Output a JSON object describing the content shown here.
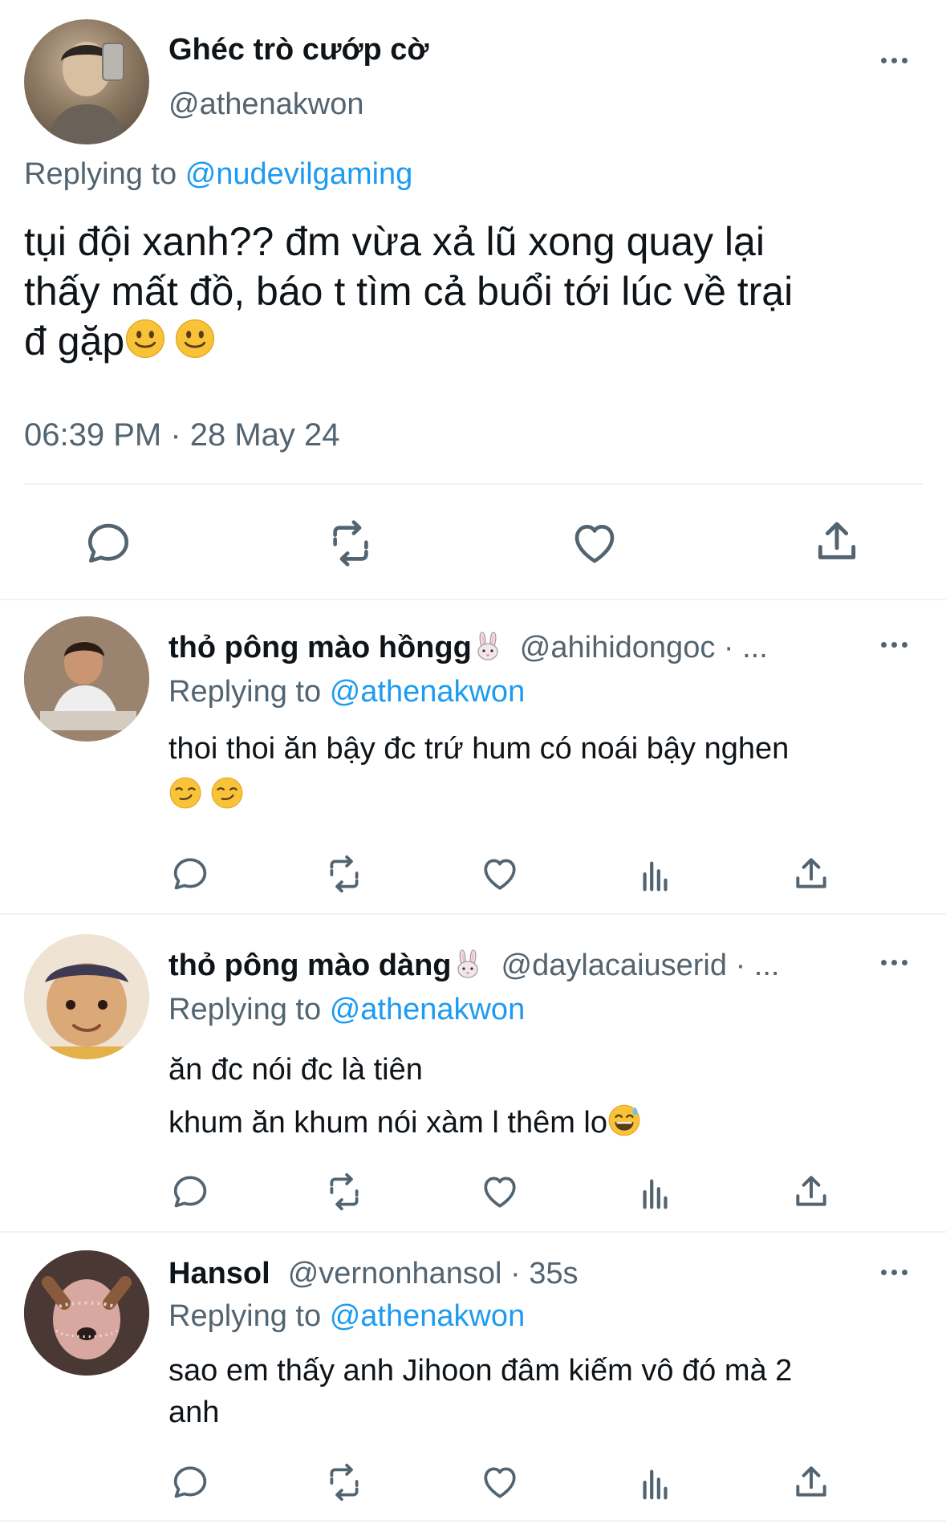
{
  "main_tweet": {
    "display_name": "Ghéc trò cướp cờ",
    "handle": "@athenakwon",
    "replying_label": "Replying to",
    "replying_to": "@nudevilgaming",
    "text_line1": "tụi đội xanh?? đm vừa xả lũ xong quay lại",
    "text_line2": "thấy mất đồ, báo t tìm cả buổi tới lúc về trại",
    "text_line3": "đ gặp",
    "timestamp": "06:39 PM · 28 May 24"
  },
  "replies": [
    {
      "display_name": "thỏ pông mào hồngg",
      "handle_meta": "@ahihidongoc · ...",
      "replying_label": "Replying to",
      "replying_to": "@athenakwon",
      "text_line1": "thoi thoi ăn bậy đc trứ hum có noái bậy nghen"
    },
    {
      "display_name": "thỏ pông mào dàng",
      "handle_meta": "@daylacaiuserid · ...",
      "replying_label": "Replying to",
      "replying_to": "@athenakwon",
      "text_line1": "ăn đc nói đc là tiên",
      "text_line2": "khum ăn khum nói xàm l thêm lo"
    },
    {
      "display_name": "Hansol",
      "handle_meta": "@vernonhansol · 35s",
      "replying_label": "Replying to",
      "replying_to": "@athenakwon",
      "text_line1": "sao em thấy anh Jihoon đâm kiếm vô đó mà 2",
      "text_line2": "anh"
    }
  ],
  "icons": {
    "reply": "reply-icon",
    "retweet": "retweet-icon",
    "like": "heart-icon",
    "views": "views-icon",
    "share": "share-icon",
    "more": "more-icon"
  },
  "colors": {
    "accent": "#1d9bf0",
    "muted": "#536471",
    "divider": "#eff3f4"
  }
}
